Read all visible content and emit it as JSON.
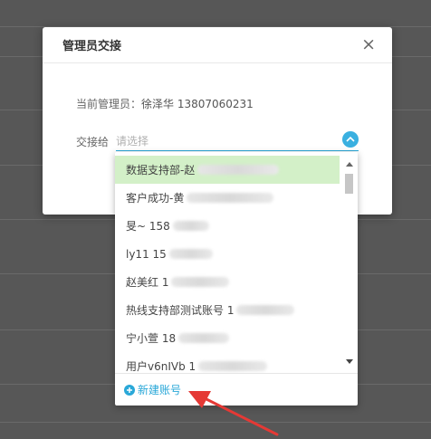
{
  "dialog": {
    "title": "管理员交接",
    "close_symbol": "×",
    "current_admin_label": "当前管理员：",
    "current_admin_value": "徐泽华 13807060231",
    "handover_label": "交接给",
    "handover_placeholder": "请选择"
  },
  "dropdown": {
    "options": [
      {
        "text": "数据支持部-赵",
        "selected": true
      },
      {
        "text": "客户成功-黄",
        "selected": false
      },
      {
        "text": "旻~ 158",
        "selected": false
      },
      {
        "text": "ly11 15",
        "selected": false
      },
      {
        "text": "赵美红 1",
        "selected": false
      },
      {
        "text": "热线支持部测试账号 1",
        "selected": false
      },
      {
        "text": "宁小萱 18",
        "selected": false
      },
      {
        "text": "用户v6nIVb 1",
        "selected": false
      }
    ],
    "footer_label": "新建账号"
  },
  "colors": {
    "accent": "#2aa8d8",
    "selected_bg": "#d3f0c8",
    "arrow_red": "#e53935"
  }
}
